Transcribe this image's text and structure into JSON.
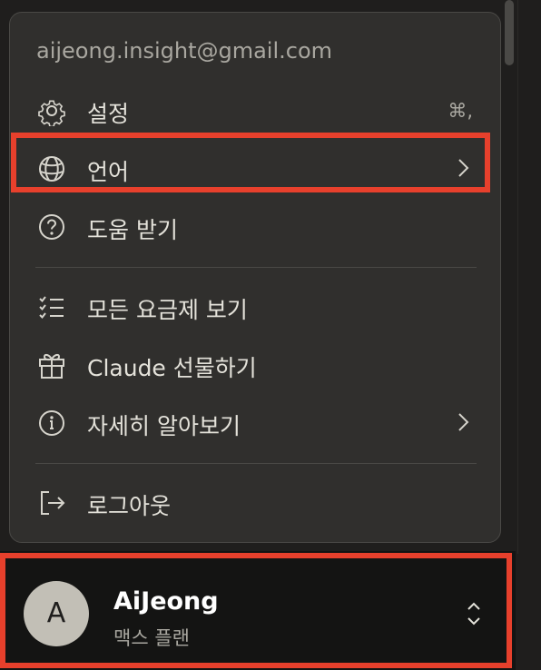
{
  "account": {
    "email": "aijeong.insight@gmail.com"
  },
  "menu": {
    "items": [
      {
        "label": "설정",
        "icon": "gear-icon",
        "shortcut": "⌘,"
      },
      {
        "label": "언어",
        "icon": "globe-icon",
        "submenu": true
      },
      {
        "label": "도움 받기",
        "icon": "help-circle-icon"
      },
      {
        "label": "모든 요금제 보기",
        "icon": "checklist-icon"
      },
      {
        "label": "Claude 선물하기",
        "icon": "gift-icon"
      },
      {
        "label": "자세히 알아보기",
        "icon": "info-icon",
        "submenu": true
      },
      {
        "label": "로그아웃",
        "icon": "logout-icon"
      }
    ]
  },
  "user": {
    "avatar_letter": "A",
    "name": "AiJeong",
    "plan": "맥스 플랜"
  },
  "colors": {
    "highlight": "#e7402c",
    "menu_bg": "#302f2d",
    "page_bg": "#1f1e1d",
    "user_bar_bg": "#141413",
    "avatar_bg": "#c2bfb6"
  }
}
